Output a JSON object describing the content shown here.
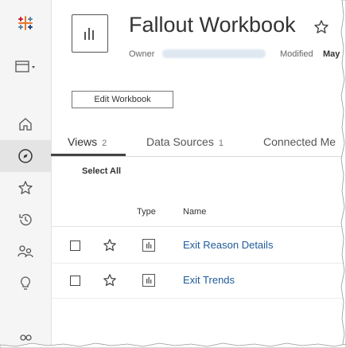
{
  "workbook": {
    "title": "Fallout Workbook",
    "owner_label": "Owner",
    "modified_label": "Modified",
    "modified_value": "May",
    "edit_button": "Edit Workbook"
  },
  "tabs": [
    {
      "label": "Views",
      "count": "2"
    },
    {
      "label": "Data Sources",
      "count": "1"
    },
    {
      "label": "Connected Me",
      "count": ""
    }
  ],
  "toolbar": {
    "select_all": "Select All"
  },
  "table": {
    "columns": {
      "type": "Type",
      "name": "Name"
    },
    "rows": [
      {
        "name": "Exit Reason Details"
      },
      {
        "name": "Exit Trends"
      }
    ]
  },
  "sidebar": {
    "items": [
      "tableau-logo-icon",
      "content-type-icon",
      "home-icon",
      "explore-icon",
      "favorites-icon",
      "recents-icon",
      "shared-with-me-icon",
      "recommendations-icon",
      "collections-icon"
    ]
  },
  "colors": {
    "link": "#1f5a99",
    "sidebar_bg": "#f5f5f5"
  }
}
